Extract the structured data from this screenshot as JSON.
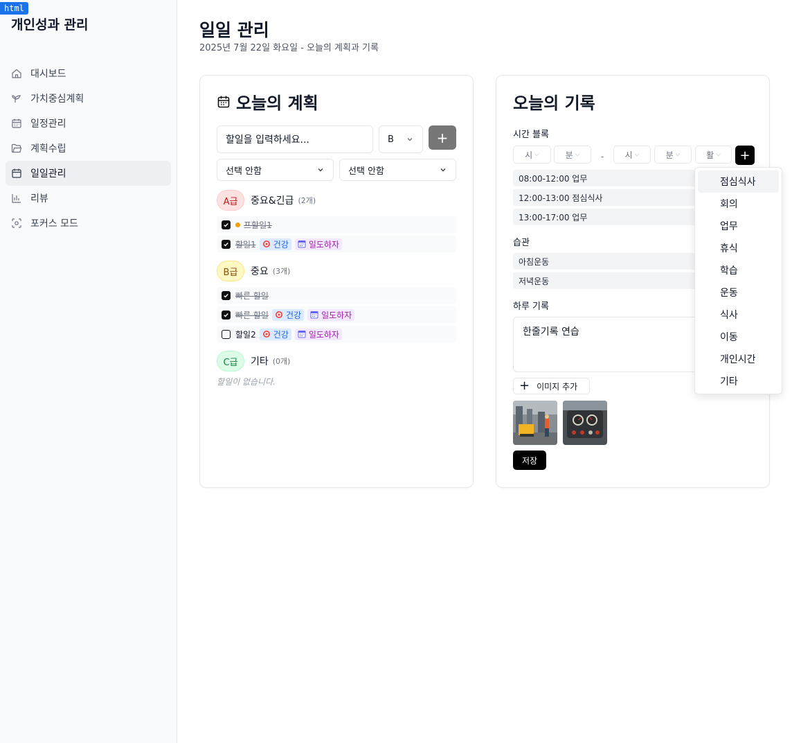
{
  "badge": "html",
  "sidebar": {
    "title": "개인성과 관리",
    "items": [
      {
        "label": "대시보드",
        "icon": "home-icon"
      },
      {
        "label": "가치중심계획",
        "icon": "sprout-icon"
      },
      {
        "label": "일정관리",
        "icon": "calendar-grid-icon"
      },
      {
        "label": "계획수립",
        "icon": "folder-icon"
      },
      {
        "label": "일일관리",
        "icon": "calendar-icon",
        "active": true
      },
      {
        "label": "리뷰",
        "icon": "bar-chart-icon"
      },
      {
        "label": "포커스 모드",
        "icon": "focus-icon"
      }
    ]
  },
  "header": {
    "title": "일일 관리",
    "subtitle": "2025년 7월 22일 화요일 - 오늘의 계획과 기록"
  },
  "plan": {
    "title": "오늘의 계획",
    "input_placeholder": "할일을 입력하세요...",
    "grade_value": "B",
    "add_label": "+",
    "select1": "선택 안함",
    "select2": "선택 안함",
    "groups": [
      {
        "grade": "A급",
        "name": "중요&긴급",
        "count": "(2개)",
        "tasks": [
          {
            "text": "프할일1",
            "checked": true,
            "dot": true,
            "tags": []
          },
          {
            "text": "할일1",
            "checked": true,
            "dot": false,
            "tags": [
              "건강",
              "일도하자"
            ]
          }
        ]
      },
      {
        "grade": "B급",
        "name": "중요",
        "count": "(3개)",
        "tasks": [
          {
            "text": "빠른 할일",
            "checked": true,
            "dot": false,
            "tags": []
          },
          {
            "text": "빠른 할일",
            "checked": true,
            "dot": false,
            "tags": [
              "건강",
              "일도하자"
            ]
          },
          {
            "text": "할일2",
            "checked": false,
            "dot": false,
            "tags": [
              "건강",
              "일도하자"
            ]
          }
        ]
      },
      {
        "grade": "C급",
        "name": "기타",
        "count": "(0개)",
        "empty": "할일이 없습니다."
      }
    ]
  },
  "record": {
    "title": "오늘의 기록",
    "time_block_label": "시간 블록",
    "time_inputs": {
      "start_hour": "시",
      "start_min": "분",
      "dash": "-",
      "end_hour": "시",
      "end_min": "분",
      "activity": "활"
    },
    "add_label": "+",
    "time_blocks": [
      "08:00-12:00 업무",
      "12:00-13:00 점심식사",
      "13:00-17:00 업무"
    ],
    "habit_label": "습관",
    "habits": [
      "아침운동",
      "저녁운동"
    ],
    "memo_label": "하루 기록",
    "memo_value": "한줄기록 연습",
    "add_image_label": "이미지 추가",
    "save_label": "저장"
  },
  "dropdown": {
    "options": [
      "점심식사",
      "회의",
      "업무",
      "휴식",
      "학습",
      "운동",
      "식사",
      "이동",
      "개인시간",
      "기타"
    ],
    "highlighted": "점심식사"
  }
}
